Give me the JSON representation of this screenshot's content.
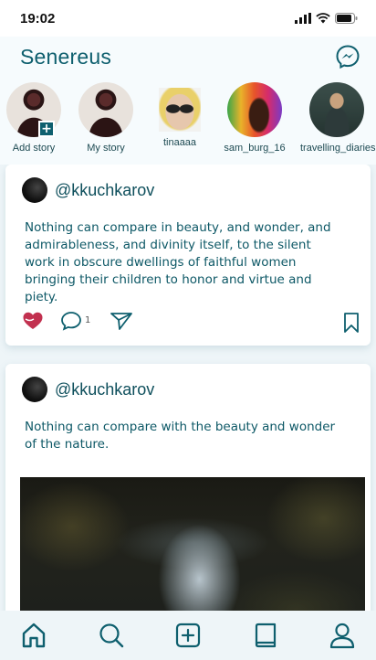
{
  "status_bar": {
    "time": "19:02"
  },
  "header": {
    "title": "Senereus"
  },
  "stories": [
    {
      "label": "Add story"
    },
    {
      "label": "My story"
    },
    {
      "label": "tinaaaa"
    },
    {
      "label": "sam_burg_16"
    },
    {
      "label": "travelling_diaries"
    }
  ],
  "posts": [
    {
      "username": "@kkuchkarov",
      "text": "Nothing can compare in beauty, and wonder, and admirableness, and divinity itself, to the silent work in obscure dwellings of faithful women bringing their children to honor and virtue and piety.",
      "comment_count": "1"
    },
    {
      "username": "@kkuchkarov",
      "text": "Nothing can compare with the beauty and wonder of the nature."
    }
  ],
  "colors": {
    "primary": "#0e5f6e",
    "like": "#c2304f",
    "background": "#eef5f8"
  },
  "tabs": [
    "home-icon",
    "search-icon",
    "add-post-icon",
    "book-icon",
    "profile-icon"
  ]
}
